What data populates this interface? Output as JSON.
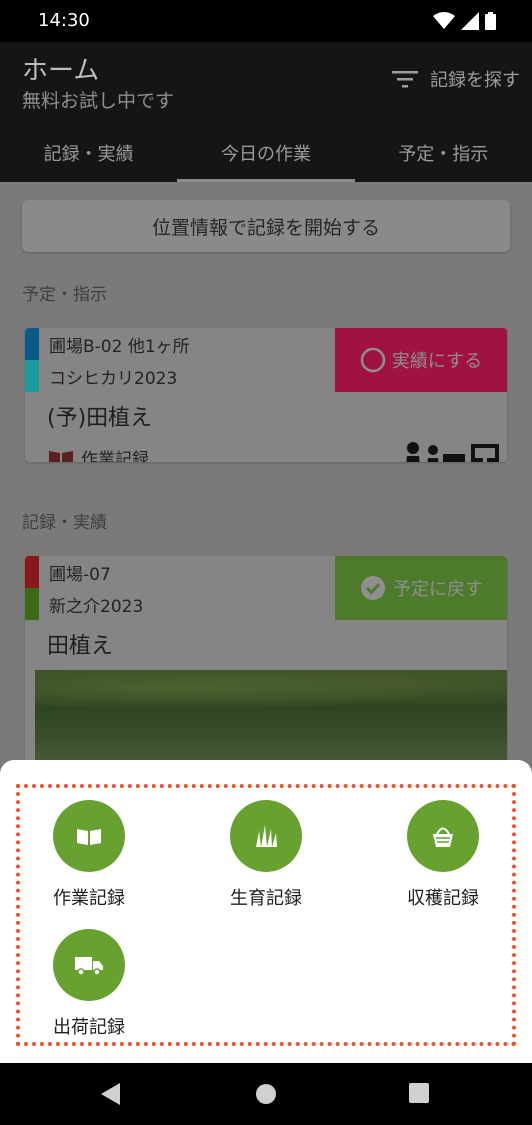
{
  "status_bar": {
    "time": "14:30"
  },
  "appbar": {
    "title": "ホーム",
    "subtitle": "無料お試し中です",
    "search_label": "記録を探す"
  },
  "tabs": [
    {
      "label": "記録・実績"
    },
    {
      "label": "今日の作業",
      "active": true
    },
    {
      "label": "予定・指示"
    }
  ],
  "location_button": "位置情報で記録を開始する",
  "sections": {
    "planned": "予定・指示",
    "records": "記録・実績"
  },
  "planned_card": {
    "field": "圃場B-02 他1ヶ所",
    "crop": "コシヒカリ2023",
    "task": "(予)田植え",
    "record_type": "作業記録",
    "action": "実績にする",
    "colors": {
      "field_bar": "#0a5a8a",
      "crop_bar": "#1a9a9a",
      "action_bg": "#a01242"
    }
  },
  "record_card": {
    "field": "圃場-07",
    "crop": "新之介2023",
    "task": "田植え",
    "action": "予定に戻す",
    "colors": {
      "field_bar": "#8a1a1a",
      "crop_bar": "#3a6a1a",
      "action_bg": "#4e7a2c"
    }
  },
  "sheet_options": [
    {
      "label": "作業記録",
      "icon": "book-icon"
    },
    {
      "label": "生育記録",
      "icon": "grass-icon"
    },
    {
      "label": "収穫記録",
      "icon": "basket-icon"
    },
    {
      "label": "出荷記録",
      "icon": "truck-icon"
    }
  ],
  "accent": "#67a230",
  "highlight_border": "#e8532a"
}
